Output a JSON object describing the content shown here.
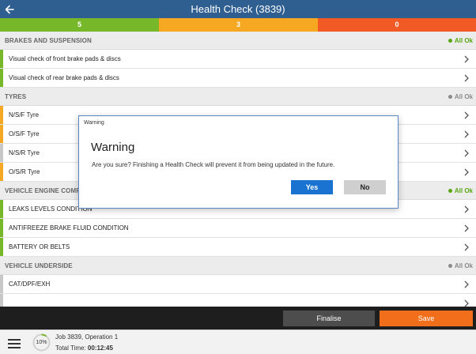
{
  "header": {
    "title": "Health Check (3839)"
  },
  "status_counts": [
    {
      "value": "5",
      "color": "#76b82a"
    },
    {
      "value": "3",
      "color": "#f7a823"
    },
    {
      "value": "0",
      "color": "#f15a24"
    }
  ],
  "sections": [
    {
      "title": "BRAKES AND SUSPENSION",
      "status": "All Ok",
      "status_color": "#5aa513",
      "items": [
        {
          "label": "Visual check of front brake pads & discs",
          "color": "#76b82a"
        },
        {
          "label": "Visual check of rear brake pads & discs",
          "color": "#76b82a"
        }
      ]
    },
    {
      "title": "TYRES",
      "status": "All Ok",
      "status_color": "#8a8a8a",
      "items": [
        {
          "label": "N/S/F Tyre",
          "color": "#f7a823"
        },
        {
          "label": "O/S/F Tyre",
          "color": "#f7a823"
        },
        {
          "label": "N/S/R Tyre",
          "color": "#c8c8c8"
        },
        {
          "label": "O/S/R Tyre",
          "color": "#f7a823"
        }
      ]
    },
    {
      "title": "VEHICLE ENGINE COMPA",
      "status": "All Ok",
      "status_color": "#5aa513",
      "items": [
        {
          "label": "LEAKS LEVELS CONDITION",
          "color": "#76b82a"
        },
        {
          "label": "ANTIFREEZE BRAKE FLUID CONDITION",
          "color": "#76b82a"
        },
        {
          "label": "BATTERY OR BELTS",
          "color": "#76b82a"
        }
      ]
    },
    {
      "title": "VEHICLE UNDERSIDE",
      "status": "All Ok",
      "status_color": "#8a8a8a",
      "items": [
        {
          "label": "CAT/DPF/EXH",
          "color": "#c8c8c8"
        },
        {
          "label": "",
          "color": "#c8c8c8"
        }
      ]
    }
  ],
  "dialog": {
    "window_title": "Warning",
    "heading": "Warning",
    "message": "Are you sure? Finishing a Health Check will prevent it from being updated in the future.",
    "yes_label": "Yes",
    "no_label": "No"
  },
  "actions": {
    "finalise_label": "Finalise",
    "save_label": "Save"
  },
  "footer": {
    "progress_text": "10%",
    "progress_value": 0.1,
    "job_line": "Job 3839, Operation 1",
    "total_time_label": "Total Time:",
    "total_time_value": "00:12:45"
  }
}
